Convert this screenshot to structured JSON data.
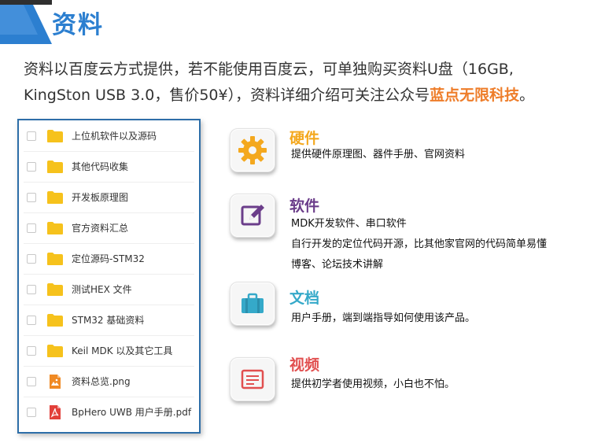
{
  "header": {
    "title": "资料"
  },
  "intro": {
    "text_before": "资料以百度云方式提供，若不能使用百度云，可单独购买资料U盘（16GB, KingSton USB 3.0，售价50¥），资料详细介绍可关注公众号",
    "highlight": "蓝点无限科技",
    "text_after": "。"
  },
  "files": [
    {
      "name": "上位机软件以及源码",
      "icon": "folder-icon"
    },
    {
      "name": "其他代码收集",
      "icon": "folder-icon"
    },
    {
      "name": "开发板原理图",
      "icon": "folder-icon"
    },
    {
      "name": "官方资料汇总",
      "icon": "folder-icon"
    },
    {
      "name": "定位源码-STM32",
      "icon": "folder-icon"
    },
    {
      "name": "测试HEX 文件",
      "icon": "folder-icon"
    },
    {
      "name": "STM32 基础资料",
      "icon": "folder-icon"
    },
    {
      "name": "Keil MDK 以及其它工具",
      "icon": "folder-icon"
    },
    {
      "name": "资料总览.png",
      "icon": "image-file-icon"
    },
    {
      "name": "BpHero UWB 用户手册.pdf",
      "icon": "pdf-file-icon"
    }
  ],
  "features": {
    "hardware": {
      "title": "硬件",
      "icon": "gear-icon",
      "color": "#f4a81e",
      "lines": [
        "提供硬件原理图、器件手册、官网资料"
      ]
    },
    "software": {
      "title": "软件",
      "icon": "edit-icon",
      "color": "#6b3d8a",
      "lines": [
        "MDK开发软件、串口软件",
        "自行开发的定位代码开源，比其他家官网的代码简单易懂",
        "博客、论坛技术讲解"
      ]
    },
    "docs": {
      "title": "文档",
      "icon": "briefcase-icon",
      "color": "#35a9c9",
      "lines": [
        "用户手册，端到端指导如何使用该产品。"
      ]
    },
    "video": {
      "title": "视频",
      "icon": "document-icon",
      "color": "#e14f4f",
      "lines": [
        "提供初学者使用视频，小白也不怕。"
      ]
    }
  },
  "colors": {
    "brand_blue": "#2c7fd0",
    "accent_orange": "#ee7d2a",
    "panel_border": "#2d6ea8",
    "folder": "#f6c21c"
  }
}
